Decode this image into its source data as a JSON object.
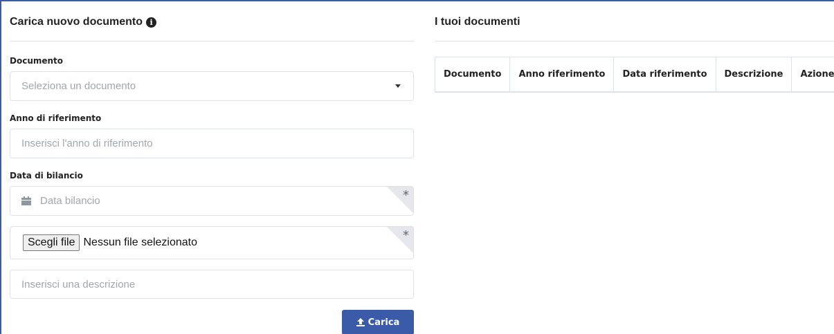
{
  "upload_panel": {
    "title": "Carica nuovo documento",
    "info_icon": "info-circle-icon",
    "document": {
      "label": "Documento",
      "placeholder": "Seleziona un documento"
    },
    "year": {
      "label": "Anno di riferimento",
      "placeholder": "Inserisci l'anno di riferimento"
    },
    "balance_date": {
      "label": "Data di bilancio",
      "placeholder": "Data bilancio",
      "required_mark": "*",
      "icon": "calendar-icon"
    },
    "file": {
      "button_label": "Scegli file",
      "status_text": "Nessun file selezionato",
      "required_mark": "*"
    },
    "description": {
      "placeholder": "Inserisci una descrizione"
    },
    "submit": {
      "label": "Carica",
      "icon": "upload-icon",
      "color": "#3b5ba8"
    }
  },
  "documents_panel": {
    "title": "I tuoi documenti",
    "columns": [
      "Documento",
      "Anno riferimento",
      "Data riferimento",
      "Descrizione",
      "Azione"
    ]
  }
}
